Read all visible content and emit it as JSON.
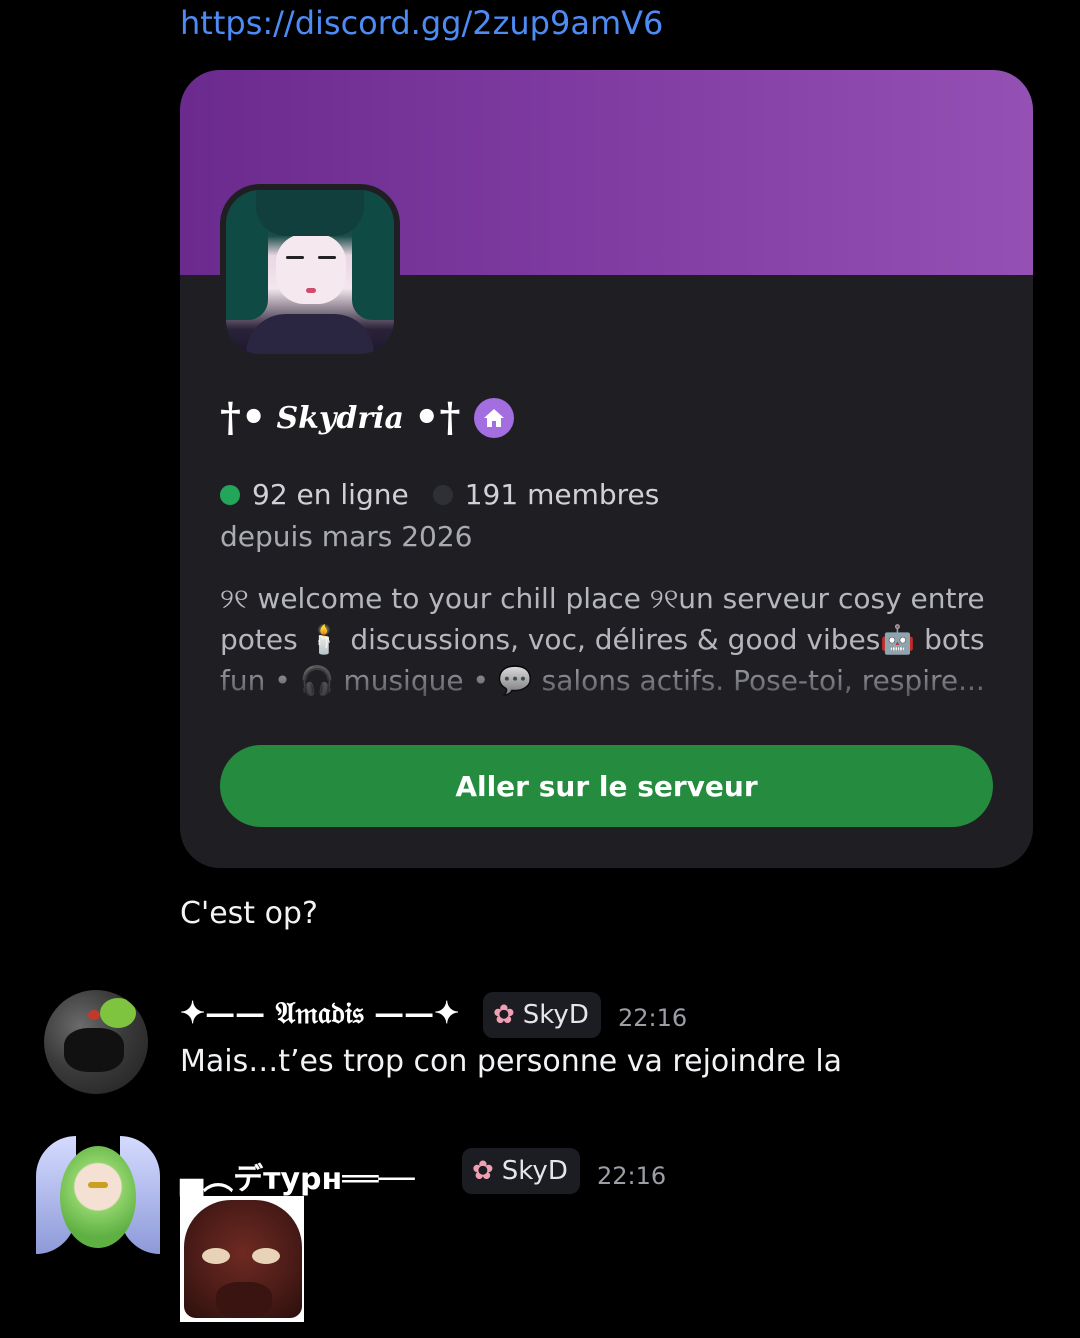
{
  "invite": {
    "url": "https://discord.gg/2zup9amV6"
  },
  "server_card": {
    "name": "✝• 𝒮𝓀𝒹𝓇𝒾𝒶•✝",
    "name_plain": "Skydria",
    "dagger_left": "†•",
    "dagger_right": "•†",
    "online": "92 en ligne",
    "members": "191 membres",
    "since": "depuis mars 2026",
    "description": "୨୧ welcome to your chill place ୨୧un serveur cosy entre potes 🕯️ discussions, voc, délires & good vibes🤖 bots fun • 🎧 musique • 💬 salons actifs. Pose-toi, respire... T’es ...",
    "button_label": "Aller sur le serveur",
    "banner_color": "#7e3aa0",
    "button_color": "#248b3f"
  },
  "messages": [
    {
      "text": "C'est op?"
    },
    {
      "username": "✦—— 𝔄𝔪𝔞𝔡𝔦𝔰 ——✦",
      "tag": "SkyD",
      "time": "22:16",
      "text": "Mais…t’es trop con personne va rejoindre la"
    },
    {
      "username": "▄︵デтурн══──",
      "tag": "SkyD",
      "time": "22:16"
    }
  ]
}
